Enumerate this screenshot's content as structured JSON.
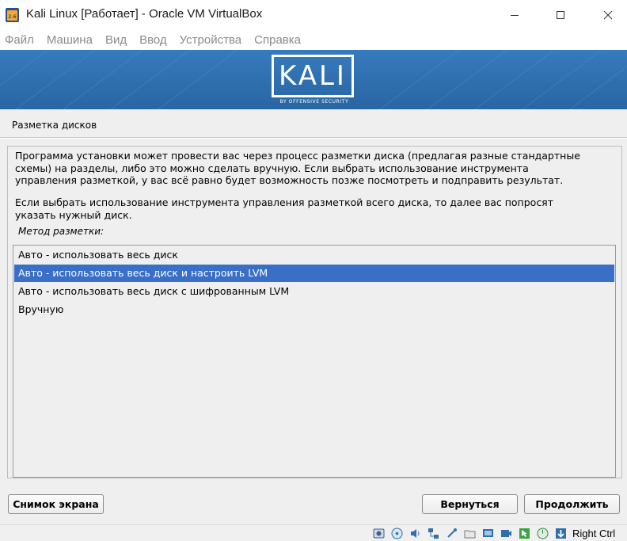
{
  "window": {
    "title": "Kali Linux [Работает] - Oracle VM VirtualBox",
    "icon_badge": "2.6"
  },
  "menubar": {
    "items": [
      "Файл",
      "Машина",
      "Вид",
      "Ввод",
      "Устройства",
      "Справка"
    ]
  },
  "banner": {
    "logo_text": "KALI",
    "logo_subtext": "BY OFFENSIVE SECURITY",
    "background": "#2f70b2"
  },
  "installer": {
    "page_title": "Разметка дисков",
    "paragraph1": "Программа установки может провести вас через процесс разметки диска (предлагая разные стандартные\nсхемы) на разделы, либо это можно сделать вручную. Если выбрать использование инструмента\nуправления разметкой, у вас всё равно будет возможность позже посмотреть и подправить результат.",
    "paragraph2": "Если выбрать использование инструмента управления разметкой всего диска, то далее вас попросят\nуказать нужный диск.",
    "method_label": "Метод разметки:",
    "options": [
      "Авто - использовать весь диск",
      "Авто - использовать весь диск и настроить LVM",
      "Авто - использовать весь диск с шифрованным LVM",
      "Вручную"
    ],
    "selected_option": "Авто - использовать весь диск и настроить LVM",
    "selection_color": "#3a6fc8",
    "buttons": {
      "screenshot": "Снимок экрана",
      "back": "Вернуться",
      "continue": "Продолжить"
    }
  },
  "statusbar": {
    "icons": [
      "hard-disk-icon",
      "optical-disc-icon",
      "audio-icon",
      "network-icon",
      "usb-icon",
      "shared-folders-icon",
      "display-icon",
      "video-capture-icon",
      "mouse-integration-icon",
      "cpu-activity-icon",
      "keyboard-capture-icon"
    ],
    "host_key": "Right Ctrl"
  }
}
